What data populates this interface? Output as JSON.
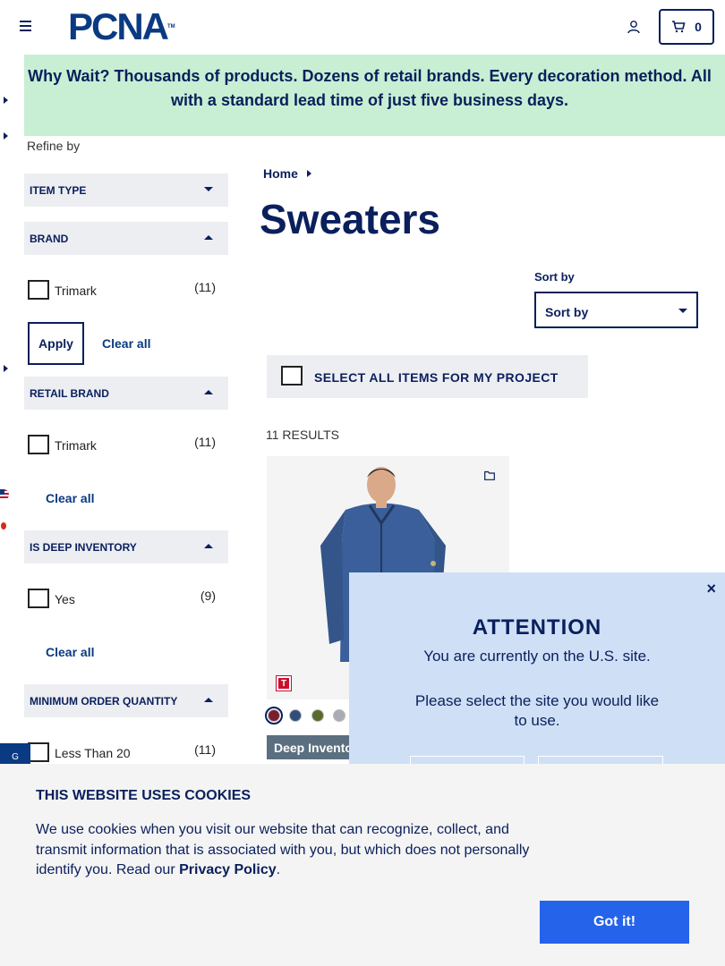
{
  "header": {
    "logo": "PCNA",
    "logo_tm": "TM",
    "cart_count": "0"
  },
  "banner": {
    "text": "Why Wait? Thousands of products. Dozens of retail brands. Every decoration method. All with a standard lead time of just five business days."
  },
  "sidebar": {
    "refine_label": "Refine by",
    "facets": {
      "item_type": "ITEM TYPE",
      "brand": "BRAND",
      "retail_brand": "RETAIL BRAND",
      "is_deep_inventory": "IS DEEP INVENTORY",
      "minimum_order_quantity": "MINIMUM ORDER QUANTITY"
    },
    "brand_option": {
      "label": "Trimark",
      "count": "(11)"
    },
    "retail_brand_option": {
      "label": "Trimark",
      "count": "(11)"
    },
    "deep_inventory_option": {
      "label": "Yes",
      "count": "(9)"
    },
    "moq_option": {
      "label": "Less Than 20",
      "count": "(11)"
    },
    "apply_label": "Apply",
    "clear_all_label": "Clear all"
  },
  "main": {
    "breadcrumb_home": "Home",
    "title": "Sweaters",
    "sort_label": "Sort by",
    "sort_value": "Sort by",
    "select_all_label": "SELECT ALL ITEMS FOR MY PROJECT",
    "results_count": "11 RESULTS",
    "product": {
      "brand_badge": "T",
      "tag": "Deep Inventory",
      "swatches": [
        "#7a1e2e",
        "#2f4f7a",
        "#5a6a2e",
        "#a9adb3"
      ]
    }
  },
  "attention_modal": {
    "close": "×",
    "title": "ATTENTION",
    "message": "You are currently on the U.S. site.",
    "question": "Please select the site you would like to use."
  },
  "cookie_banner": {
    "title": "THIS WEBSITE USES COOKIES",
    "text_before": "We use cookies when you visit our website that can recognize, collect, and transmit information that is associated with you, but which does not personally identify you. Read our ",
    "privacy_link": "Privacy Policy",
    "text_after": ".",
    "button_label": "Got it!"
  },
  "feedback_tab": {
    "label": "G"
  }
}
